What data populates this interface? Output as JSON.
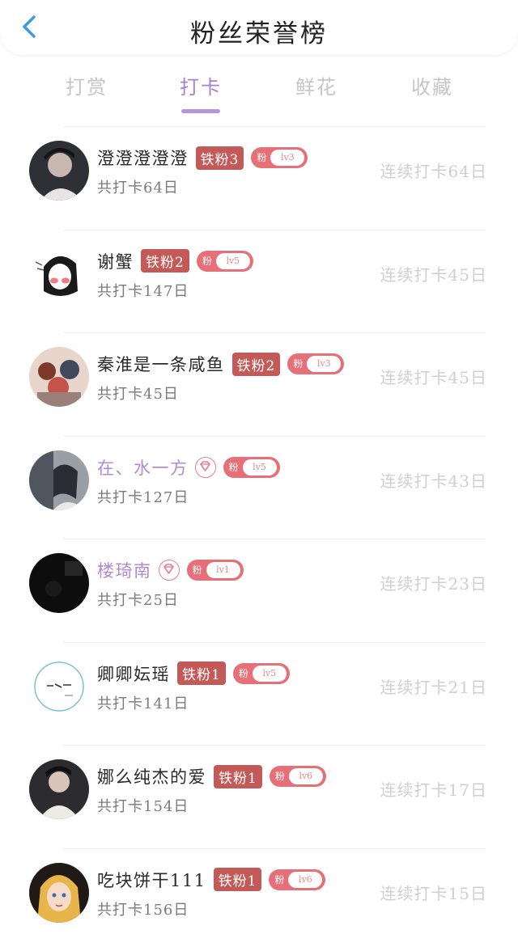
{
  "header": {
    "title": "粉丝荣誉榜"
  },
  "tabs": [
    {
      "label": "打赏",
      "active": false
    },
    {
      "label": "打卡",
      "active": true
    },
    {
      "label": "鲜花",
      "active": false
    },
    {
      "label": "收藏",
      "active": false
    }
  ],
  "rows": [
    {
      "name": "澄澄澄澄澄",
      "badge": "铁粉3",
      "fen": "粉",
      "level": "lv3",
      "total": "共打卡64日",
      "streak": "连续打卡64日",
      "vip": false,
      "avatar_color": "#3a3a44"
    },
    {
      "name": "谢蟹",
      "badge": "铁粉2",
      "fen": "粉",
      "level": "lv5",
      "total": "共打卡147日",
      "streak": "连续打卡45日",
      "vip": false,
      "avatar_color": "#f3eeee"
    },
    {
      "name": "秦淮是一条咸鱼",
      "badge": "铁粉2",
      "fen": "粉",
      "level": "lv3",
      "total": "共打卡45日",
      "streak": "连续打卡45日",
      "vip": false,
      "avatar_color": "#c89d8c"
    },
    {
      "name": "在、水一方",
      "badge": "",
      "fen": "粉",
      "level": "lv5",
      "total": "共打卡127日",
      "streak": "连续打卡43日",
      "vip": true,
      "avatar_color": "#7a7f88"
    },
    {
      "name": "楼琦南",
      "badge": "",
      "fen": "粉",
      "level": "lv1",
      "total": "共打卡25日",
      "streak": "连续打卡23日",
      "vip": true,
      "avatar_color": "#111111"
    },
    {
      "name": "卿卿妘瑶",
      "badge": "铁粉1",
      "fen": "粉",
      "level": "lv5",
      "total": "共打卡141日",
      "streak": "连续打卡21日",
      "vip": false,
      "avatar_color": "#f6f8f8"
    },
    {
      "name": "娜么纯杰的爱",
      "badge": "铁粉1",
      "fen": "粉",
      "level": "lv6",
      "total": "共打卡154日",
      "streak": "连续打卡17日",
      "vip": false,
      "avatar_color": "#2c2c30"
    },
    {
      "name": "吃块饼干111",
      "badge": "铁粉1",
      "fen": "粉",
      "level": "lv6",
      "total": "共打卡156日",
      "streak": "连续打卡15日",
      "vip": false,
      "avatar_color": "#e0b25a"
    }
  ]
}
